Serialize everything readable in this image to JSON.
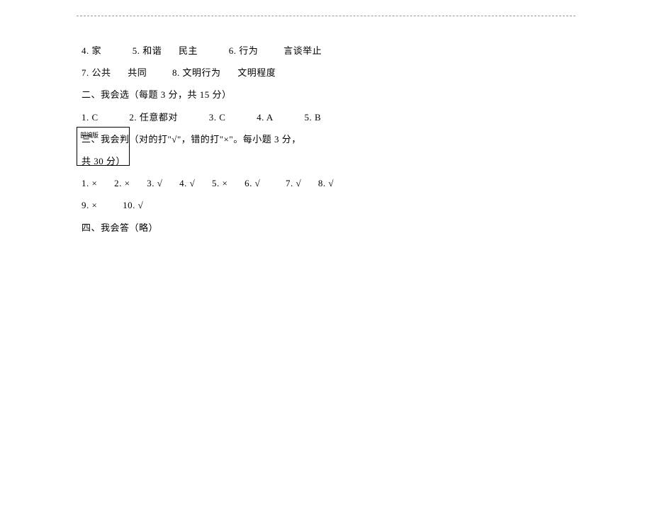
{
  "box_label": "部编版",
  "lines": {
    "l1_a": "4. 家",
    "l1_b": "5. 和谐",
    "l1_c": "民主",
    "l1_d": "6. 行为",
    "l1_e": "言谈举止",
    "l2_a": "7. 公共",
    "l2_b": "共同",
    "l2_c": "8. 文明行为",
    "l2_d": "文明程度",
    "l3": "二、我会选（每题 3 分，共 15 分）",
    "l4_a": "1. C",
    "l4_b": "2. 任意都对",
    "l4_c": "3. C",
    "l4_d": "4. A",
    "l4_e": "5. B",
    "l5": "三、我会判（对的打\"√\"，错的打\"×\"。每小题 3 分，",
    "l6": "共 30 分）",
    "l7_a": "1. ×",
    "l7_b": "2. ×",
    "l7_c": "3. √",
    "l7_d": "4. √",
    "l7_e": "5. ×",
    "l7_f": "6. √",
    "l7_g": "7. √",
    "l7_h": "8. √",
    "l8_a": "9. ×",
    "l8_b": "10. √",
    "l9": "四、我会答（略）"
  }
}
